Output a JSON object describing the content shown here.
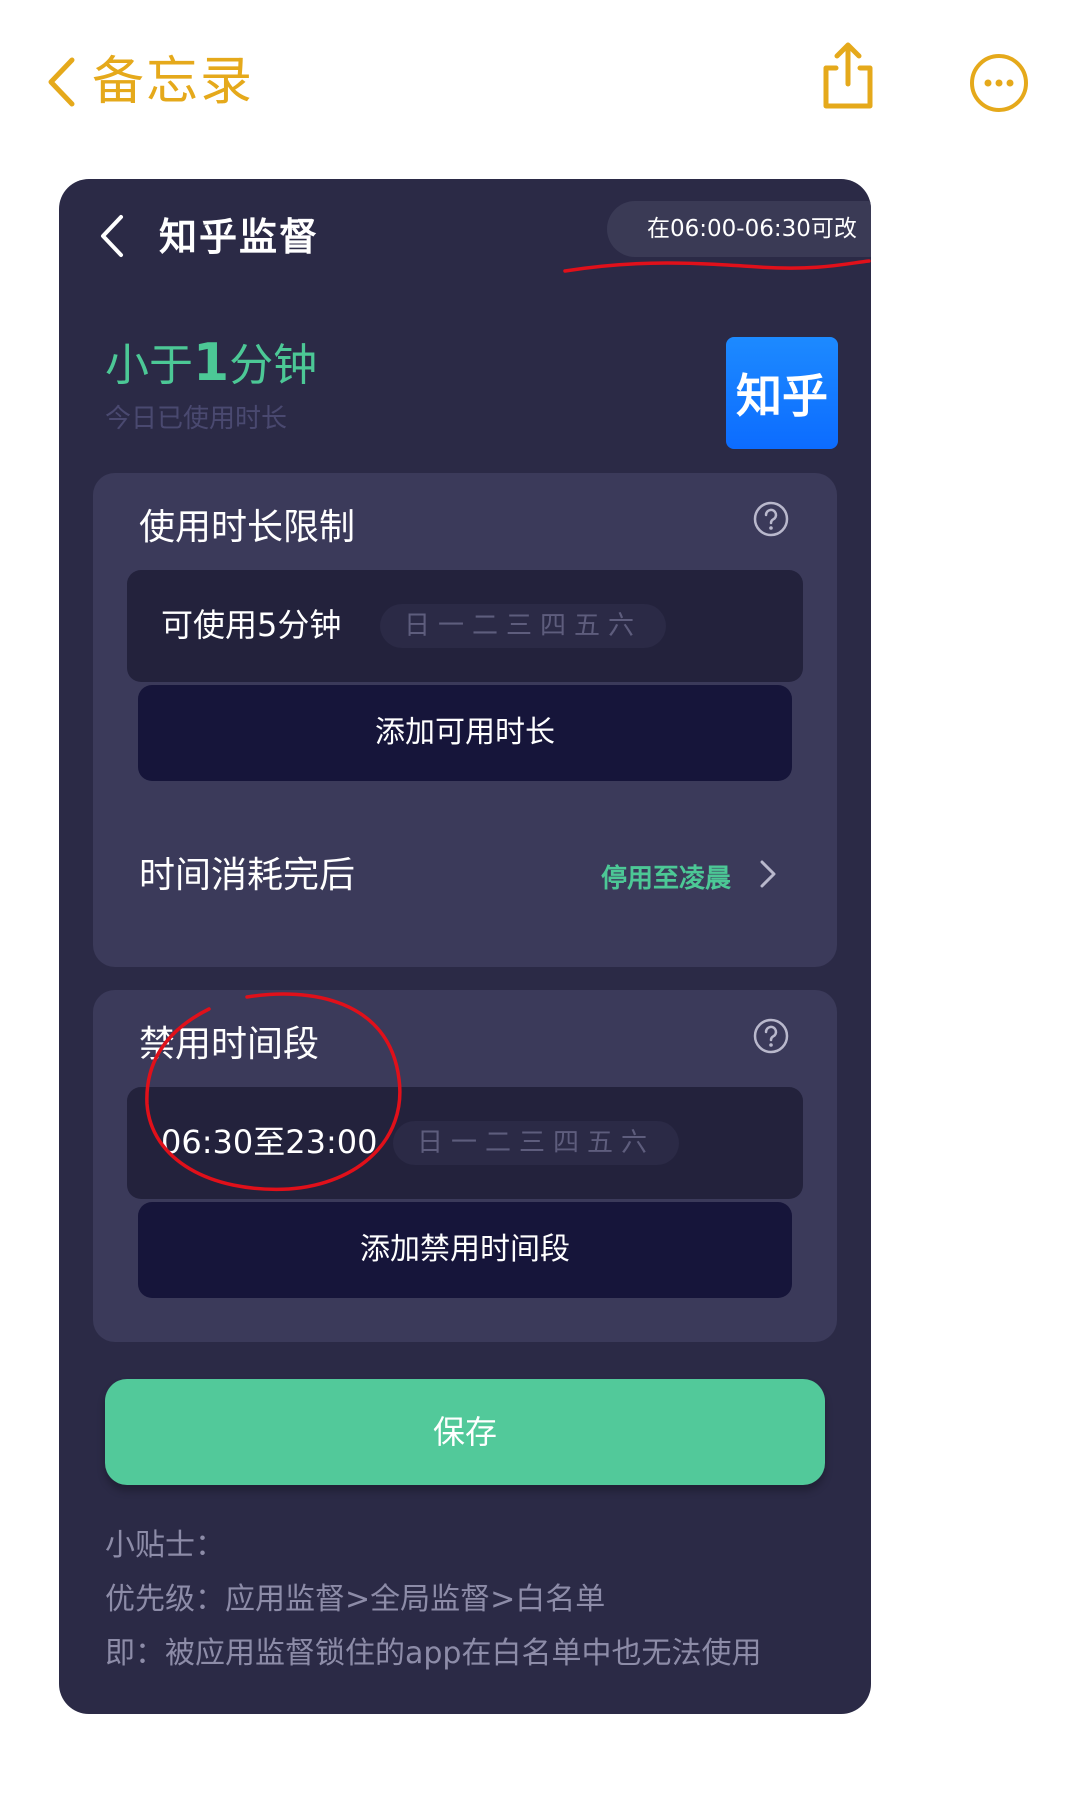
{
  "notes_bar": {
    "back_label": "备忘录",
    "accent_color": "#E5A91B",
    "icons": [
      "chevron-left-icon",
      "share-icon",
      "more-icon"
    ]
  },
  "card": {
    "title": "知乎监督",
    "edit_window_note": "在06:00-06:30可改",
    "usage": {
      "prefix": "小于",
      "number": "1",
      "suffix": "分钟",
      "caption": "今日已使用时长"
    },
    "app_icon_text": "知乎",
    "duration_limit": {
      "title": "使用时长限制",
      "rule_text": "可使用5分钟",
      "days": "日一二三四五六",
      "add_button": "添加可用时长",
      "after_label": "时间消耗完后",
      "after_value": "停用至凌晨"
    },
    "blocked_period": {
      "title": "禁用时间段",
      "rule_text": "06:30至23:00",
      "days": "日一二三四五六",
      "add_button": "添加禁用时间段"
    },
    "save_button": "保存",
    "tips": [
      "小贴士：",
      "优先级：应用监督>全局监督>白名单",
      "即：被应用监督锁住的app在白名单中也无法使用"
    ],
    "colors": {
      "background": "#2B2A46",
      "panel": "#3B3A5A",
      "green": "#4CC896",
      "save": "#52C99A",
      "annotation_red": "#E0101A"
    }
  }
}
